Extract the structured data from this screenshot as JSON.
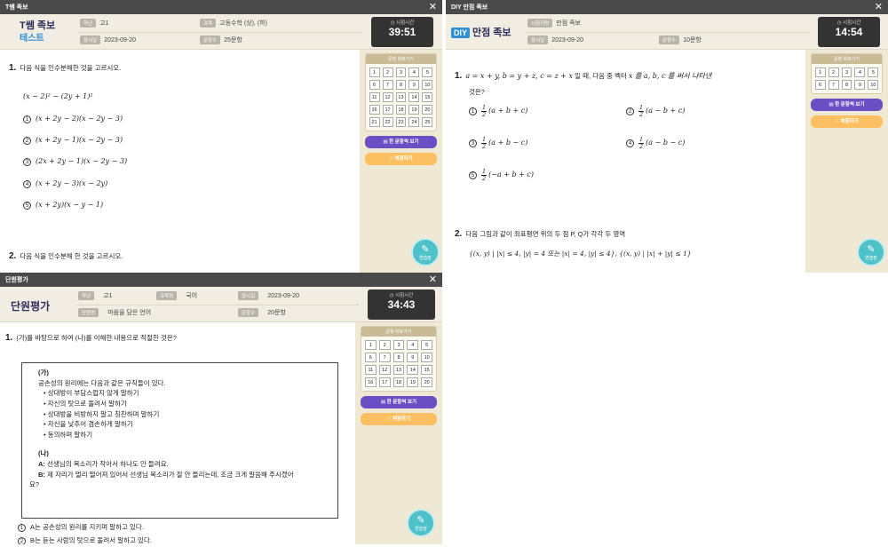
{
  "win1": {
    "title": "T쌤 족보",
    "brand_line1": "T쌤 족보",
    "brand_line2": "테스트",
    "grade_label": "학년",
    "grade_value": "고1",
    "subject_label": "과목",
    "subject_value": "고등수학 (상), (하)",
    "date_label": "응시일",
    "date_value": "2023-09-20",
    "count_label": "문항수",
    "count_value": "25문항",
    "timer_label": "시험시간",
    "timer_value": "39:51",
    "palette_title": "문항 바로가기",
    "palette_numbers": [
      "1",
      "2",
      "3",
      "4",
      "5",
      "6",
      "7",
      "8",
      "9",
      "10",
      "11",
      "12",
      "13",
      "14",
      "15",
      "16",
      "17",
      "18",
      "19",
      "20",
      "21",
      "22",
      "23",
      "24",
      "25"
    ],
    "btn_view_all": "한 문항씩 보기",
    "btn_grade": "채점하기",
    "fab_label": "연습장",
    "q1_num": "1.",
    "q1_text": "다음 식을 인수분해한 것을 고르시오.",
    "q1_expr": "(x − 2)² − (2y + 1)²",
    "q1_options": [
      "(x + 2y − 2)(x − 2y − 3)",
      "(x + 2y − 1)(x − 2y − 3)",
      "(2x + 2y − 1)(x − 2y − 3)",
      "(x + 2y − 3)(x − 2y)",
      "(x + 2y)(x − y − 1)"
    ],
    "q2_num": "2.",
    "q2_text": "다음 식을 인수분해 한 것을 고르시오."
  },
  "win2": {
    "title": "DIY 만점 족보",
    "brand_diy": "DIY",
    "brand_text": "만점 족보",
    "exam_label": "시험지명",
    "exam_value": "만점 족보",
    "date_label": "응시일",
    "date_value": "2023-09-20",
    "count_label": "문항수",
    "count_value": "10문항",
    "timer_label": "시험시간",
    "timer_value": "14:54",
    "palette_title": "문항 바로가기",
    "palette_numbers": [
      "1",
      "2",
      "3",
      "4",
      "5",
      "6",
      "7",
      "8",
      "9",
      "10"
    ],
    "btn_view_all": "한 문항씩 보기",
    "btn_grade": "채점하기",
    "fab_label": "연습장",
    "q1_num": "1.",
    "q1_text_a": "a = x + y,  b = y + z,  c = z + x",
    "q1_text_b": "일 때, 다음 중 벡터",
    "q1_text_c": "x 를 a, b, c 를 써서 나타낸",
    "q1_text_d": "것은?",
    "q1_half": "1",
    "q1_den": "2",
    "q1_options": [
      "(a + b + c)",
      "(a − b + c)",
      "(a + b − c)",
      "(a − b − c)",
      "(−a + b + c)"
    ],
    "q2_num": "2.",
    "q2_text": "다음 그림과 같이 좌표평면 위의 두 점 P, Q가 각각 두 영역",
    "q2_expr": "{(x, y) | |x| ≤ 4, |y| = 4 또는 |x| = 4, |y| ≤ 4}, {(x, y) | |x| + |y| ≤ 1}"
  },
  "win3": {
    "title": "단원평가",
    "brand": "단원평가",
    "grade_label": "학년",
    "grade_value": "고1",
    "subject_label": "과목명",
    "subject_value": "국어",
    "date_label": "응시일",
    "date_value": "2023-09-20",
    "unit_label": "단원명",
    "unit_value": "마음을 담은 언어",
    "count_label": "문항수",
    "count_value": "20문항",
    "timer_label": "시험시간",
    "timer_value": "34:43",
    "palette_title": "문항 바로가기",
    "palette_numbers": [
      "1",
      "2",
      "3",
      "4",
      "5",
      "6",
      "7",
      "8",
      "9",
      "10",
      "11",
      "12",
      "13",
      "14",
      "15",
      "16",
      "17",
      "18",
      "19",
      "20"
    ],
    "btn_view_all": "한 문항씩 보기",
    "btn_grade": "채점하기",
    "fab_label": "연습장",
    "q1_num": "1.",
    "q1_text": "(가)를 바탕으로 하여 (나)를 이해한 내용으로 적절한 것은?",
    "box_ga": "(가)",
    "box_intro": "공손성의 원리에는 다음과 같은 규칙들이 있다.",
    "box_rules": [
      "상대방이 부담스럽지 않게 말하기",
      "자신의 탓으로 돌려서 말하기",
      "상대방을 비방하지 말고 칭찬하며 말하기",
      "자신을 낮추어 겸손하게 말하기",
      "동의하며 말하기"
    ],
    "box_na": "(나)",
    "dialog_a_speaker": "A:",
    "dialog_a": "선생님의 목소리가 작아서 하나도 안 들려요.",
    "dialog_b_speaker": "B:",
    "dialog_b": "제 자리가 멀리 떨어져 있어서 선생님 목소리가 잘 안 들리는데, 조금 크게 말씀해 주시겠어",
    "dialog_b2": "요?",
    "opt1": "A는 공손성의 원리를 지키며 말하고 있다.",
    "opt2": "B는 듣는 사람의 탓으로 돌려서 말하고 있다."
  }
}
